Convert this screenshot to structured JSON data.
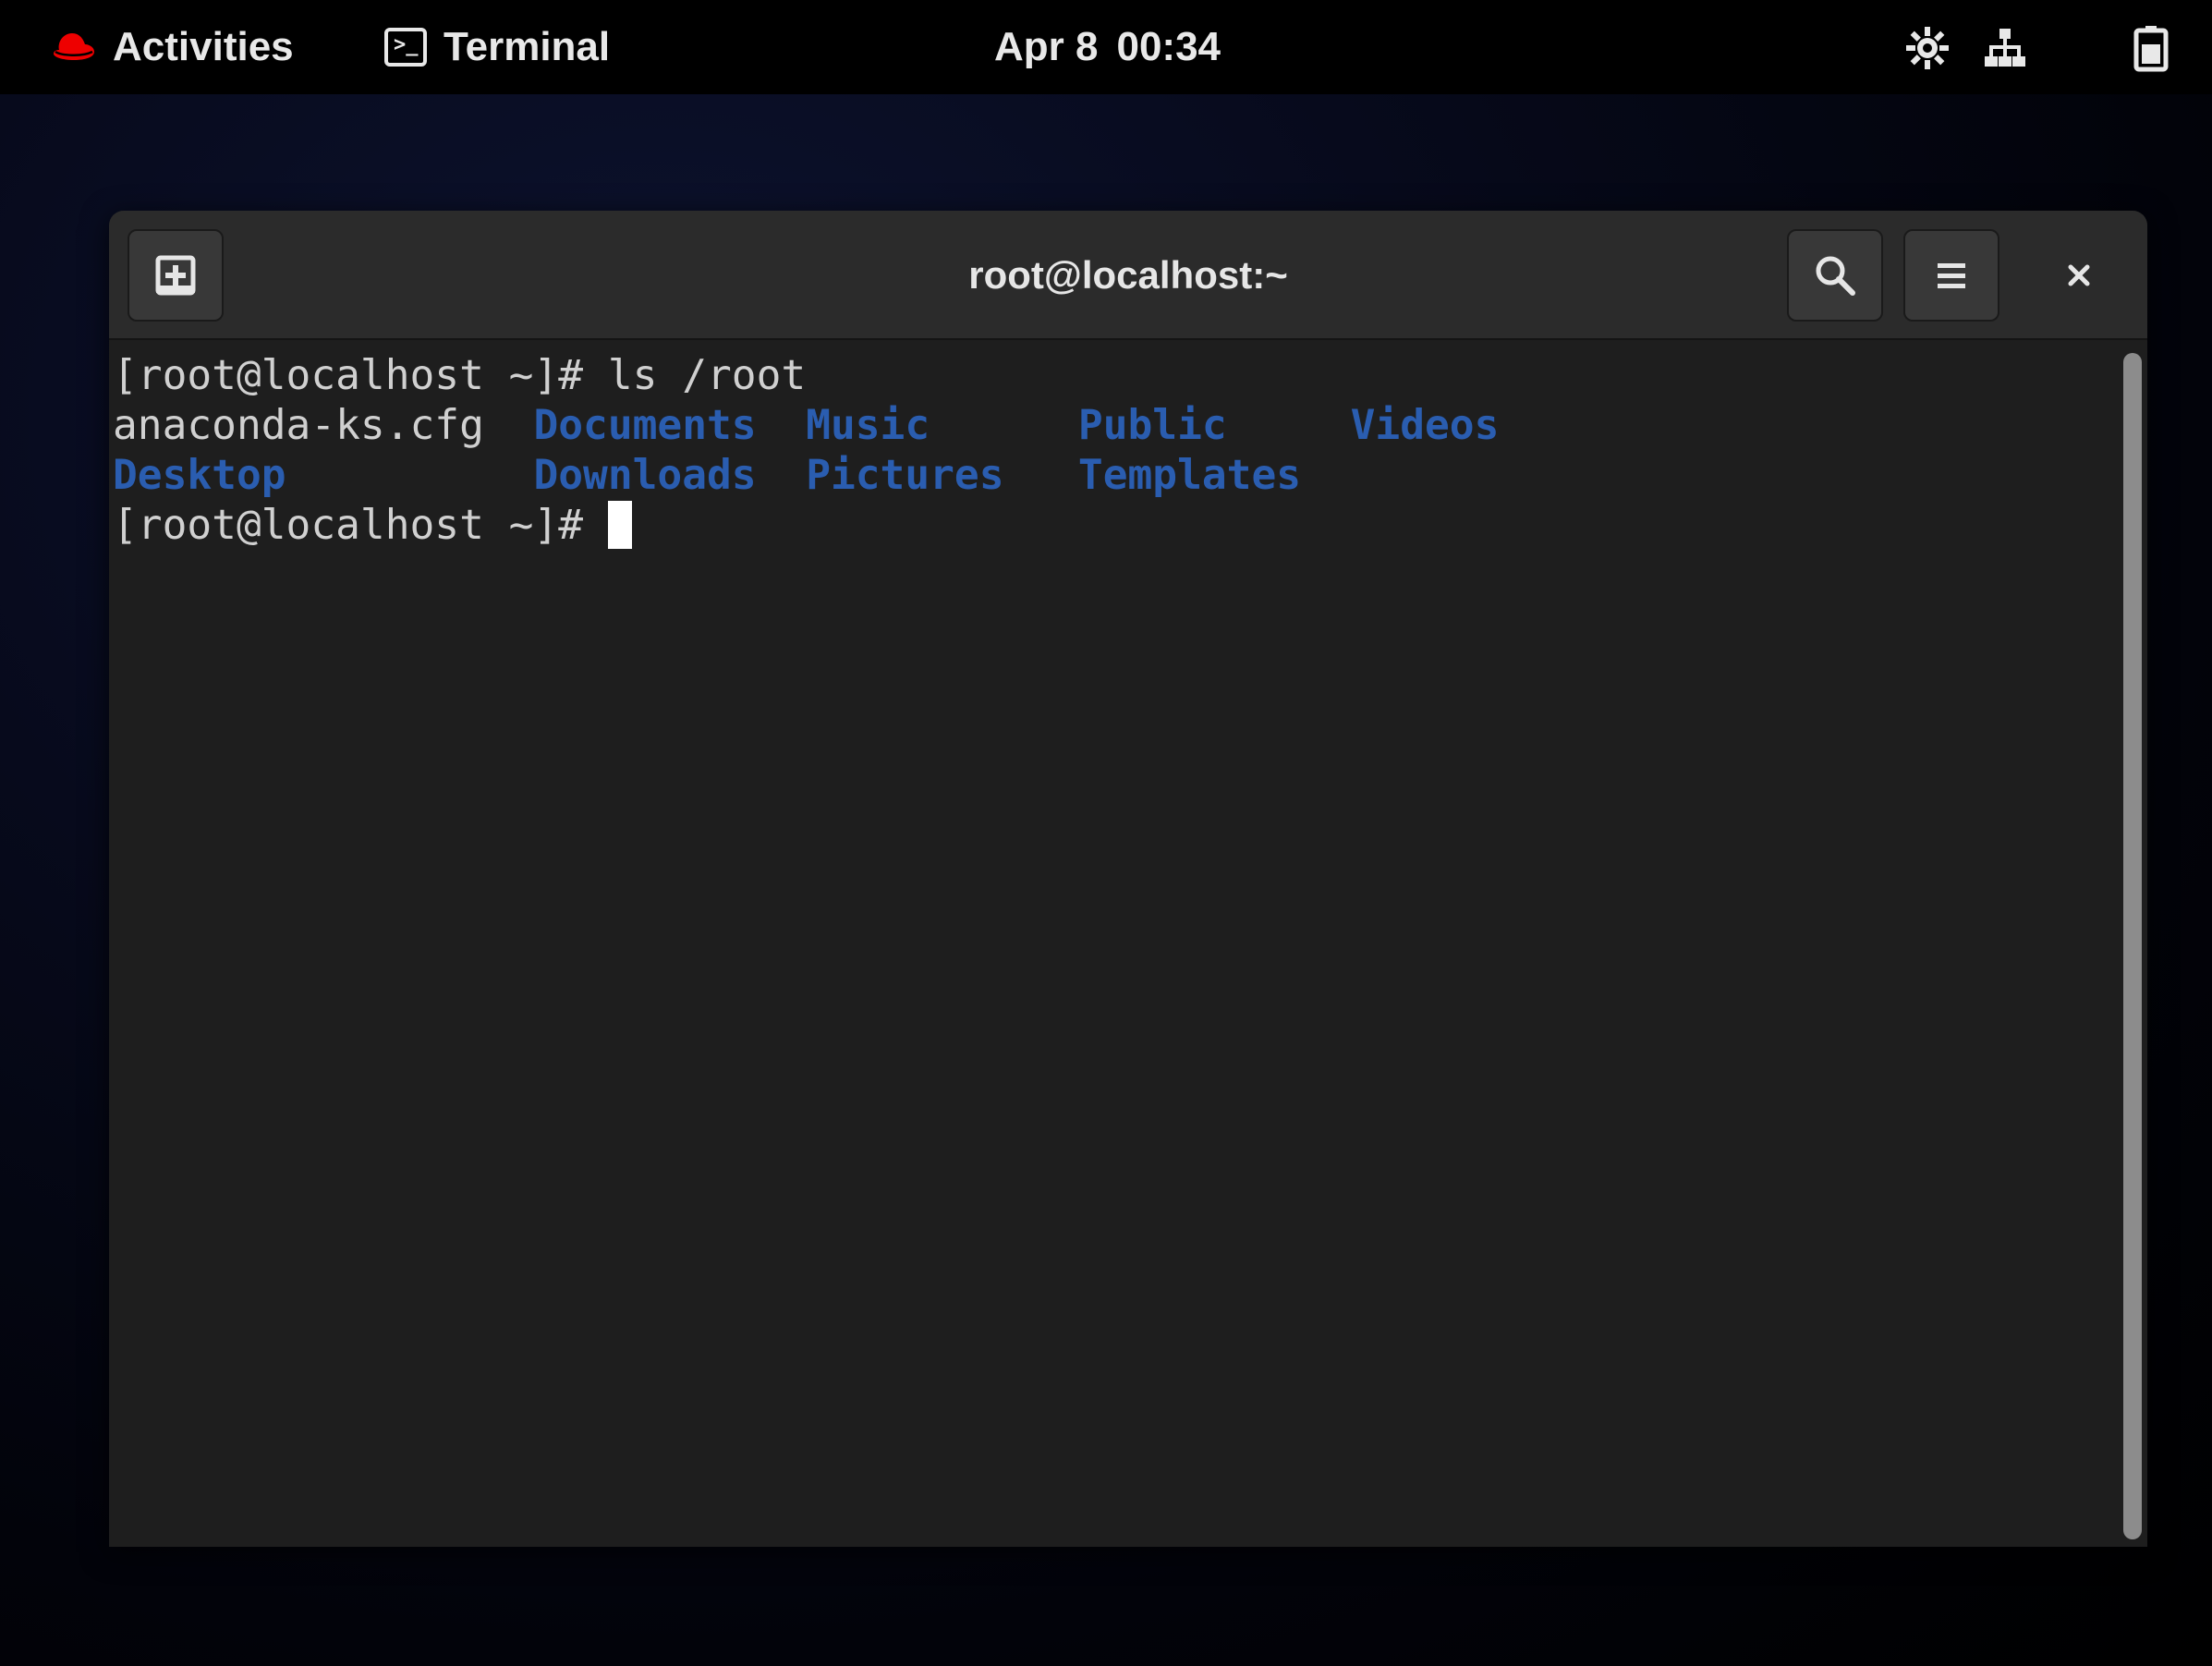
{
  "topbar": {
    "activities_label": "Activities",
    "app_name": "Terminal",
    "date": "Apr 8",
    "time": "00:34"
  },
  "window": {
    "title": "root@localhost:~"
  },
  "terminal": {
    "prompt": "[root@localhost ~]# ",
    "command": "ls /root",
    "files": {
      "cfg": "anaconda-ks.cfg",
      "documents": "Documents",
      "music": "Music",
      "public": "Public",
      "videos": "Videos",
      "desktop": "Desktop",
      "downloads": "Downloads",
      "pictures": "Pictures",
      "templates": "Templates"
    }
  },
  "colors": {
    "directory": "#2a5db0",
    "text": "#d0d0d0",
    "redhat": "#ee0000"
  },
  "icons": {
    "new_tab": "new-tab-icon",
    "search": "search-icon",
    "menu": "hamburger-menu-icon",
    "close": "close-icon",
    "accessibility": "accessibility-icon",
    "network": "network-wired-icon",
    "battery": "battery-icon"
  }
}
